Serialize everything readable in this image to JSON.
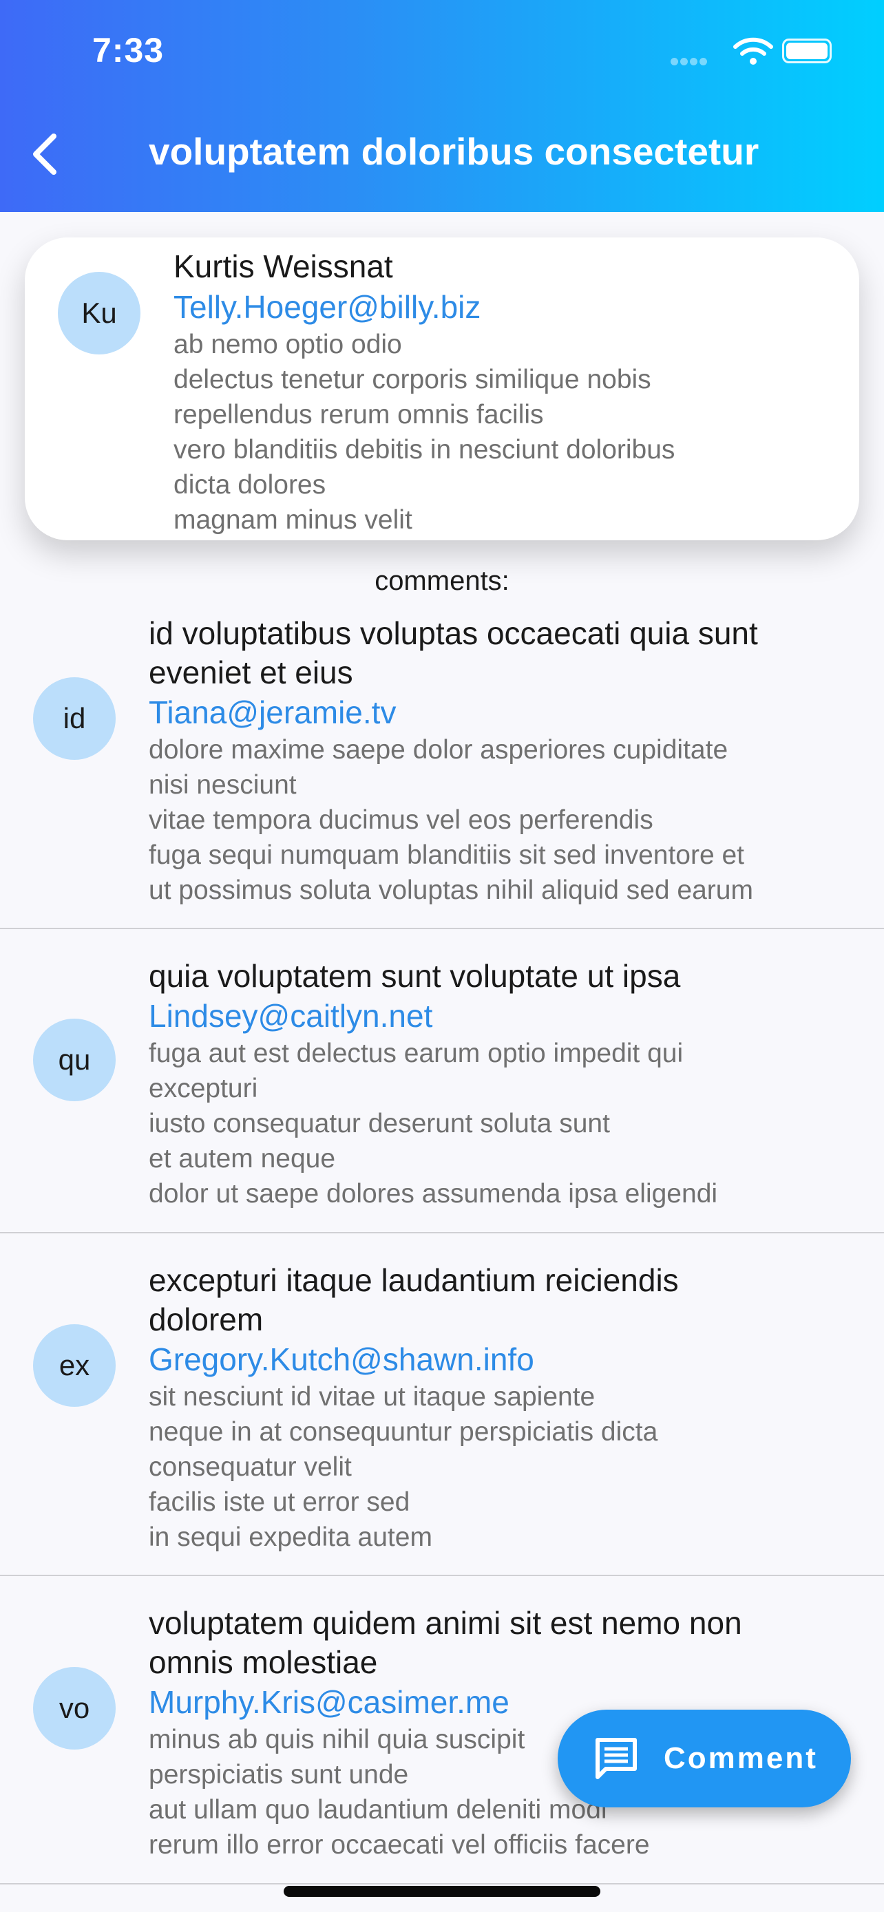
{
  "status_bar": {
    "time": "7:33"
  },
  "header": {
    "title": "voluptatem doloribus consectetur"
  },
  "post": {
    "avatar": "Ku",
    "name": "Kurtis Weissnat",
    "email": "Telly.Hoeger@billy.biz",
    "body": [
      "ab nemo optio odio",
      "delectus tenetur corporis similique nobis",
      "repellendus rerum omnis facilis",
      "vero blanditiis debitis in nesciunt doloribus",
      "dicta dolores",
      "magnam minus velit"
    ]
  },
  "comments_label": "comments:",
  "comments": [
    {
      "avatar": "id",
      "title": [
        "id voluptatibus voluptas occaecati quia sunt",
        "eveniet et eius"
      ],
      "email": "Tiana@jeramie.tv",
      "body": [
        "dolore maxime saepe dolor asperiores cupiditate",
        "nisi nesciunt",
        "vitae tempora ducimus vel eos perferendis",
        "fuga sequi numquam blanditiis sit sed inventore et",
        "ut possimus soluta voluptas nihil aliquid sed earum"
      ]
    },
    {
      "avatar": "qu",
      "title": [
        "quia voluptatem sunt voluptate ut ipsa"
      ],
      "email": "Lindsey@caitlyn.net",
      "body": [
        "fuga aut est delectus earum optio impedit qui",
        "excepturi",
        "iusto consequatur deserunt soluta sunt",
        "et autem neque",
        "dolor ut saepe dolores assumenda ipsa eligendi"
      ]
    },
    {
      "avatar": "ex",
      "title": [
        "excepturi itaque laudantium reiciendis",
        "dolorem"
      ],
      "email": "Gregory.Kutch@shawn.info",
      "body": [
        "sit nesciunt id vitae ut itaque sapiente",
        "neque in at consequuntur perspiciatis dicta",
        "consequatur velit",
        "facilis iste ut error sed",
        "in sequi expedita autem"
      ]
    },
    {
      "avatar": "vo",
      "title": [
        "voluptatem quidem animi sit est nemo non",
        "omnis molestiae"
      ],
      "email": "Murphy.Kris@casimer.me",
      "body": [
        "minus ab quis nihil quia suscipit",
        "perspiciatis sunt unde",
        "aut ullam quo laudantium deleniti modi",
        "rerum illo error occaecati vel officiis facere"
      ]
    }
  ],
  "fab": {
    "label": "Comment"
  },
  "icons": {
    "back": "chevron-left-icon",
    "fab": "comment-icon",
    "wifi": "wifi-icon",
    "battery": "battery-icon",
    "signal": "signal-icon"
  },
  "colors": {
    "header_gradient_start": "#3E6AF7",
    "header_gradient_end": "#00CFFF",
    "email": "#2D8BE6",
    "avatar_bg": "#BBDEFB",
    "fab_bg": "#2196F3"
  }
}
